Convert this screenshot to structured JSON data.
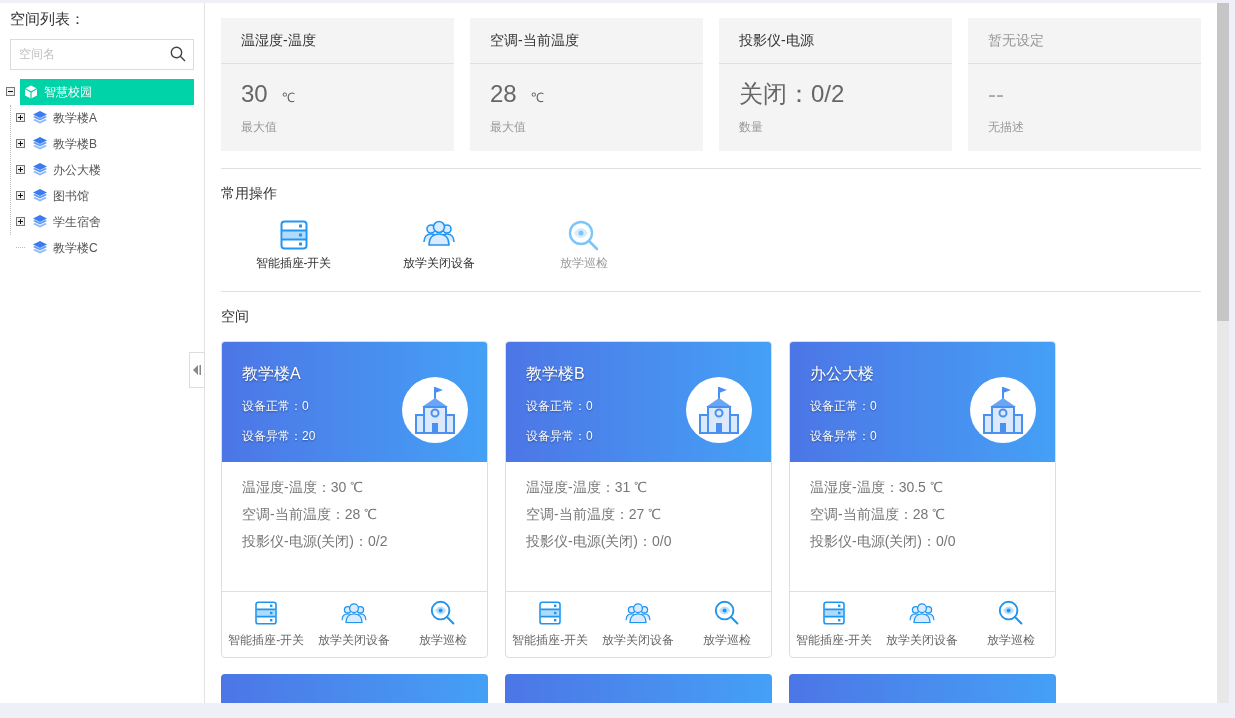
{
  "sidebar": {
    "title": "空间列表：",
    "search": {
      "placeholder": "空间名"
    },
    "tree": {
      "label": "智慧校园",
      "selected": true,
      "expanded": true,
      "children": [
        {
          "label": "教学楼A",
          "selected": false,
          "expandable": true
        },
        {
          "label": "教学楼B",
          "selected": false,
          "expandable": true
        },
        {
          "label": "办公大楼",
          "selected": false,
          "expandable": true
        },
        {
          "label": "图书馆",
          "selected": false,
          "expandable": true
        },
        {
          "label": "学生宿舍",
          "selected": false,
          "expandable": true
        },
        {
          "label": "教学楼C",
          "selected": false,
          "expandable": false
        }
      ]
    }
  },
  "stats": [
    {
      "title": "温湿度-温度",
      "value": "30",
      "unit": "℃",
      "caption": "最大值",
      "disabled": false
    },
    {
      "title": "空调-当前温度",
      "value": "28",
      "unit": "℃",
      "caption": "最大值",
      "disabled": false
    },
    {
      "title": "投影仪-电源",
      "value": "关闭：0/2",
      "caption": "数量",
      "disabled": false
    },
    {
      "title": "暂无设定",
      "value": "--",
      "caption": "无描述",
      "disabled": true
    }
  ],
  "common_ops": {
    "title": "常用操作",
    "items": [
      {
        "kind": "socket",
        "label": "智能插座-开关",
        "disabled": false
      },
      {
        "kind": "people",
        "label": "放学关闭设备",
        "disabled": false
      },
      {
        "kind": "inspect",
        "label": "放学巡检",
        "disabled": true
      }
    ]
  },
  "spaces": {
    "title": "空间",
    "cards": [
      {
        "name": "教学楼A",
        "normal": "设备正常：0",
        "abnormal": "设备异常：20",
        "lines": [
          "温湿度-温度：30 ℃",
          "空调-当前温度：28 ℃",
          "投影仪-电源(关闭)：0/2"
        ],
        "actions": [
          {
            "kind": "socket",
            "label": "智能插座-开关"
          },
          {
            "kind": "people",
            "label": "放学关闭设备"
          },
          {
            "kind": "inspect",
            "label": "放学巡检"
          }
        ]
      },
      {
        "name": "教学楼B",
        "normal": "设备正常：0",
        "abnormal": "设备异常：0",
        "lines": [
          "温湿度-温度：31 ℃",
          "空调-当前温度：27 ℃",
          "投影仪-电源(关闭)：0/0"
        ],
        "actions": [
          {
            "kind": "socket",
            "label": "智能插座-开关"
          },
          {
            "kind": "people",
            "label": "放学关闭设备"
          },
          {
            "kind": "inspect",
            "label": "放学巡检"
          }
        ]
      },
      {
        "name": "办公大楼",
        "normal": "设备正常：0",
        "abnormal": "设备异常：0",
        "lines": [
          "温湿度-温度：30.5 ℃",
          "空调-当前温度：28 ℃",
          "投影仪-电源(关闭)：0/0"
        ],
        "actions": [
          {
            "kind": "socket",
            "label": "智能插座-开关"
          },
          {
            "kind": "people",
            "label": "放学关闭设备"
          },
          {
            "kind": "inspect",
            "label": "放学巡检"
          }
        ]
      }
    ],
    "next_row": [
      {
        "kind": "space-card"
      },
      {
        "kind": "space-card"
      },
      {
        "kind": "space-card"
      }
    ]
  }
}
